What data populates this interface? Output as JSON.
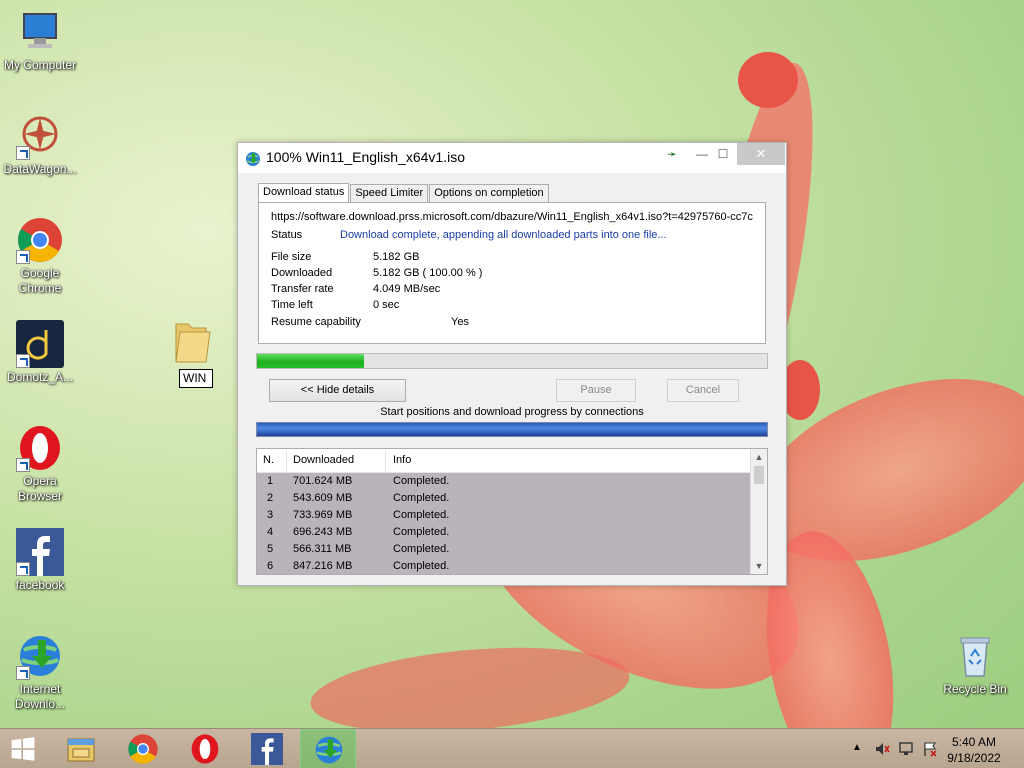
{
  "desktop": {
    "icons": [
      {
        "label": "My Computer"
      },
      {
        "label": "DataWagon..."
      },
      {
        "label": "Google Chrome"
      },
      {
        "label": "Domotz_A..."
      },
      {
        "label": "Opera Browser"
      },
      {
        "label": "facebook"
      },
      {
        "label": "Internet Downlo..."
      },
      {
        "label": "Recycle Bin"
      }
    ],
    "folder_rename_value": "WIN"
  },
  "window": {
    "title": "100% Win11_English_x64v1.iso",
    "minimize": "—",
    "maximize": "☐",
    "close": "✕",
    "tabs": [
      "Download status",
      "Speed Limiter",
      "Options on completion"
    ],
    "url": "https://software.download.prss.microsoft.com/dbazure/Win11_English_x64v1.iso?t=42975760-cc7c",
    "status_label": "Status",
    "status_value": "Download complete, appending all downloaded parts into one file...",
    "file_size_label": "File size",
    "file_size_value": "5.182  GB",
    "downloaded_label": "Downloaded",
    "downloaded_value": "5.182  GB  ( 100.00 % )",
    "transfer_rate_label": "Transfer rate",
    "transfer_rate_value": "4.049  MB/sec",
    "time_left_label": "Time left",
    "time_left_value": "0 sec",
    "resume_label": "Resume capability",
    "resume_value": "Yes",
    "progress_fraction": 0.21,
    "hide_details_label": "<< Hide details",
    "pause_label": "Pause",
    "cancel_label": "Cancel",
    "connections_label": "Start positions and download progress by connections",
    "list": {
      "headers": [
        "N.",
        "Downloaded",
        "Info"
      ],
      "rows": [
        {
          "n": "1",
          "downloaded": "701.624  MB",
          "info": "Completed."
        },
        {
          "n": "2",
          "downloaded": "543.609  MB",
          "info": "Completed."
        },
        {
          "n": "3",
          "downloaded": "733.969  MB",
          "info": "Completed."
        },
        {
          "n": "4",
          "downloaded": "696.243  MB",
          "info": "Completed."
        },
        {
          "n": "5",
          "downloaded": "566.311  MB",
          "info": "Completed."
        },
        {
          "n": "6",
          "downloaded": "847.216  MB",
          "info": "Completed."
        }
      ]
    }
  },
  "taskbar": {
    "time": "5:40 AM",
    "date": "9/18/2022"
  },
  "colors": {
    "progress_green": "#1fb020",
    "status_blue": "#1a3ea8",
    "taskbar": "#c0ae98"
  }
}
